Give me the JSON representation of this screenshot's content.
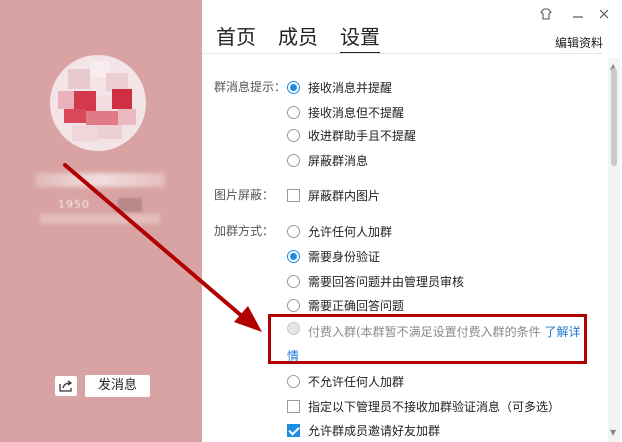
{
  "profile": {
    "id_fragment": "1950",
    "share_icon": "share-icon",
    "send_message_label": "发消息"
  },
  "tabs": [
    {
      "label": "首页"
    },
    {
      "label": "成员"
    },
    {
      "label": "设置"
    }
  ],
  "edit_label": "编辑资料",
  "titlebar_icons": [
    "skin-icon",
    "minimize-icon",
    "close-icon"
  ],
  "settings": {
    "notify_label": "群消息提示：",
    "notify_options": [
      {
        "label": "接收消息并提醒",
        "checked": true
      },
      {
        "label": "接收消息但不提醒",
        "checked": false
      },
      {
        "label": "收进群助手且不提醒",
        "checked": false
      },
      {
        "label": "屏蔽群消息",
        "checked": false
      }
    ],
    "image_label": "图片屏蔽：",
    "image_option": {
      "label": "屏蔽群内图片",
      "checked": false
    },
    "join_label": "加群方式：",
    "join_options": [
      {
        "label": "允许任何人加群",
        "checked": false
      },
      {
        "label": "需要身份验证",
        "checked": true
      },
      {
        "label": "需要回答问题并由管理员审核",
        "checked": false
      },
      {
        "label": "需要正确回答问题",
        "checked": false
      }
    ],
    "paid_join": {
      "label": "付费入群(本群暂不满足设置付费入群的条件",
      "link": "了解详情",
      "disabled": true
    },
    "deny_all": {
      "label": "不允许任何人加群",
      "checked": false
    },
    "admin_no_notify": {
      "label": "指定以下管理员不接收加群验证消息（可多选）",
      "checked": false
    },
    "allow_invite": {
      "label": "允许群成员邀请好友加群",
      "checked": true
    }
  },
  "accent_colors": {
    "highlight_box": "#b00000",
    "radio_checked": "#1c8de0",
    "left_panel": "#d9a3a3"
  }
}
